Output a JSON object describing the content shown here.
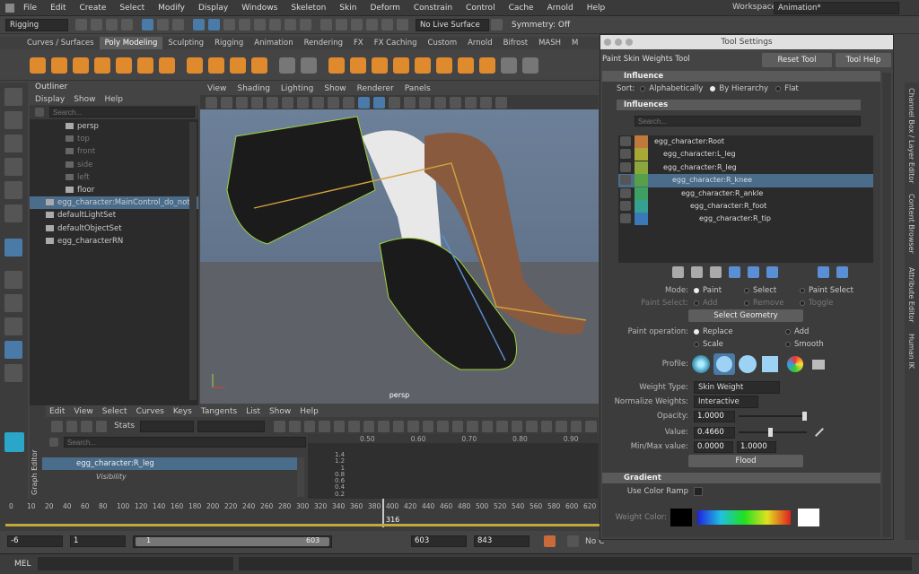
{
  "menu": [
    "File",
    "Edit",
    "Create",
    "Select",
    "Modify",
    "Display",
    "Windows",
    "Skeleton",
    "Skin",
    "Deform",
    "Constrain",
    "Control",
    "Cache",
    "Arnold",
    "Help"
  ],
  "workspace": {
    "label": "Workspace:",
    "value": "Animation*"
  },
  "status": {
    "mode": "Rigging",
    "live_surface": "No Live Surface",
    "symmetry": "Symmetry: Off"
  },
  "shelf_tabs": [
    "Curves / Surfaces",
    "Poly Modeling",
    "Sculpting",
    "Rigging",
    "Animation",
    "Rendering",
    "FX",
    "FX Caching",
    "Custom",
    "Arnold",
    "Bifrost",
    "MASH",
    "M"
  ],
  "outliner": {
    "title": "Outliner",
    "menu": [
      "Display",
      "Show",
      "Help"
    ],
    "search_placeholder": "Search...",
    "items": [
      {
        "label": "persp",
        "state": "normal"
      },
      {
        "label": "top",
        "state": "dim"
      },
      {
        "label": "front",
        "state": "dim"
      },
      {
        "label": "side",
        "state": "dim"
      },
      {
        "label": "left",
        "state": "dim"
      },
      {
        "label": "floor",
        "state": "normal"
      },
      {
        "label": "egg_character:MainControl_do_not_",
        "state": "sel"
      },
      {
        "label": "defaultLightSet",
        "state": "normal"
      },
      {
        "label": "defaultObjectSet",
        "state": "normal"
      },
      {
        "label": "egg_characterRN",
        "state": "normal"
      }
    ]
  },
  "viewport": {
    "menu": [
      "View",
      "Shading",
      "Lighting",
      "Show",
      "Renderer",
      "Panels"
    ],
    "camera": "persp"
  },
  "graph_editor": {
    "side_label": "Graph Editor",
    "menu": [
      "Edit",
      "View",
      "Select",
      "Curves",
      "Keys",
      "Tangents",
      "List",
      "Show",
      "Help"
    ],
    "stats": "Stats",
    "search_placeholder": "Search...",
    "node": "egg_character:R_leg",
    "attr": "Visibility",
    "ruler": [
      "0.50",
      "0.60",
      "0.70",
      "0.80",
      "0.90"
    ],
    "y_ticks": [
      "1.4",
      "1.2",
      "1",
      "0.8",
      "0.6",
      "0.4",
      "0.2"
    ]
  },
  "timeline": {
    "ticks": [
      "0",
      "10",
      "20",
      "40",
      "60",
      "80",
      "100",
      "120",
      "140",
      "160",
      "180",
      "200",
      "220",
      "240",
      "260",
      "280",
      "300",
      "320",
      "340",
      "360",
      "380",
      "400",
      "420",
      "440",
      "460",
      "480",
      "500",
      "520",
      "540",
      "560",
      "580",
      "600",
      "620"
    ],
    "current": "316"
  },
  "range": {
    "start": "-6",
    "anim_start": "1",
    "slider_start": "1",
    "slider_end": "603",
    "end": "603",
    "anim_end": "843",
    "no_char": "No C"
  },
  "mel_label": "MEL",
  "tool_settings": {
    "title": "Tool Settings",
    "tool_name": "Paint Skin Weights Tool",
    "reset": "Reset Tool",
    "help": "Tool Help",
    "influence_section": "Influence",
    "sort_label": "Sort:",
    "sort_options": [
      "Alphabetically",
      "By Hierarchy",
      "Flat"
    ],
    "influences_label": "Influences",
    "search_placeholder": "Search...",
    "influences": [
      {
        "label": "egg_character:Root",
        "color": "#c0793c",
        "indent": 0,
        "sel": false
      },
      {
        "label": "egg_character:L_leg",
        "color": "#a8a836",
        "indent": 1,
        "sel": false
      },
      {
        "label": "egg_character:R_leg",
        "color": "#8aa63c",
        "indent": 1,
        "sel": false
      },
      {
        "label": "egg_character:R_knee",
        "color": "#55a048",
        "indent": 2,
        "sel": true
      },
      {
        "label": "egg_character:R_ankle",
        "color": "#3ea060",
        "indent": 3,
        "sel": false
      },
      {
        "label": "egg_character:R_foot",
        "color": "#35a090",
        "indent": 4,
        "sel": false
      },
      {
        "label": "egg_character:R_tip",
        "color": "#3a78b8",
        "indent": 5,
        "sel": false
      }
    ],
    "mode_label": "Mode:",
    "mode_options": [
      "Paint",
      "Select",
      "Paint Select"
    ],
    "paint_select_label": "Paint Select:",
    "paint_select_options": [
      "Add",
      "Remove",
      "Toggle"
    ],
    "select_geometry": "Select Geometry",
    "paint_op_label": "Paint operation:",
    "paint_ops": [
      "Replace",
      "Add",
      "Scale",
      "Smooth"
    ],
    "profile_label": "Profile:",
    "weight_type_label": "Weight Type:",
    "weight_type": "Skin Weight",
    "normalize_label": "Normalize Weights:",
    "normalize": "Interactive",
    "opacity_label": "Opacity:",
    "opacity": "1.0000",
    "value_label": "Value:",
    "value": "0.4660",
    "minmax_label": "Min/Max value:",
    "min": "0.0000",
    "max": "1.0000",
    "flood": "Flood",
    "gradient_section": "Gradient",
    "color_ramp_label": "Use Color Ramp",
    "weight_color_label": "Weight Color:"
  },
  "right_strip": [
    "Channel Box / Layer Editor",
    "Content Browser",
    "Attribute Editor",
    "Human IK"
  ]
}
